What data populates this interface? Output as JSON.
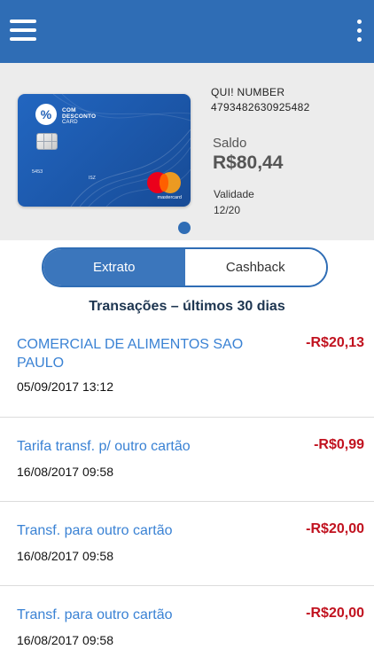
{
  "card": {
    "brand_line1": "COM",
    "brand_line2": "DESCONTO",
    "brand_line3": "CARD",
    "logo_symbol": "%",
    "printed_number": "5453",
    "mid_text": "ISZ",
    "network": "mastercard"
  },
  "account": {
    "name": "QUI! NUMBER",
    "number": "4793482630925482",
    "saldo_label": "Saldo",
    "saldo_value": "R$80,44",
    "validade_label": "Validade",
    "validade_value": "12/20"
  },
  "tabs": {
    "active": "Extrato",
    "inactive": "Cashback"
  },
  "section_title": "Transações – últimos 30 dias",
  "transactions": [
    {
      "description": "COMERCIAL DE ALIMENTOS SAO PAULO",
      "amount": "-R$20,13",
      "datetime": "05/09/2017 13:12"
    },
    {
      "description": "Tarifa transf. p/ outro cartão",
      "amount": "-R$0,99",
      "datetime": "16/08/2017 09:58"
    },
    {
      "description": "Transf. para outro cartão",
      "amount": "-R$20,00",
      "datetime": "16/08/2017 09:58"
    },
    {
      "description": "Transf. para outro cartão",
      "amount": "-R$20,00",
      "datetime": "16/08/2017 09:58"
    }
  ],
  "colors": {
    "primary": "#2f6db5",
    "link_text": "#3a82d4",
    "negative_amount": "#c1121f",
    "panel_bg": "#ececec"
  },
  "icons": {
    "menu": "hamburger-menu-icon",
    "more": "more-vertical-icon"
  }
}
